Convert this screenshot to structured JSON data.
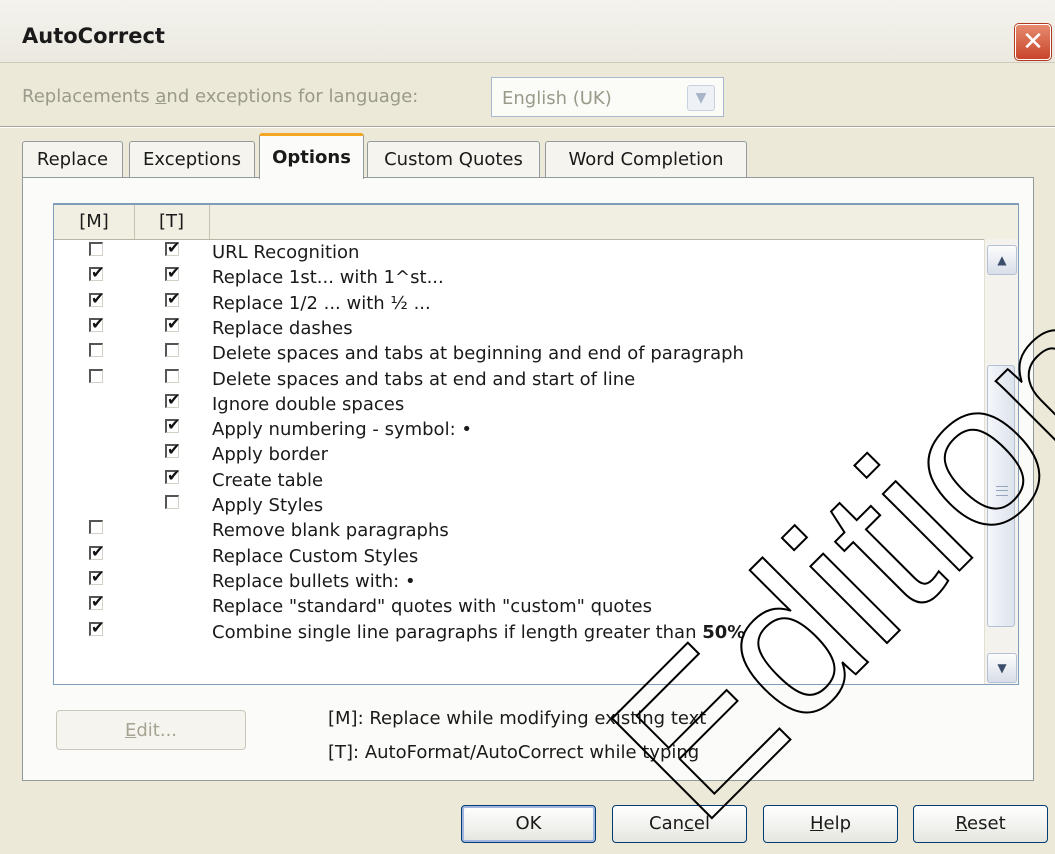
{
  "dialog": {
    "title": "AutoCorrect",
    "close_symbol": "✕"
  },
  "language": {
    "label_pre": "Replacements ",
    "label_accel": "a",
    "label_post": "nd exceptions for language:",
    "value": "English (UK)"
  },
  "tabs": [
    {
      "label": "Replace",
      "active": false
    },
    {
      "label": "Exceptions",
      "active": false
    },
    {
      "label": "Options",
      "active": true
    },
    {
      "label": "Custom Quotes",
      "active": false
    },
    {
      "label": "Word Completion",
      "active": false
    }
  ],
  "list": {
    "columns": [
      "[M]",
      "[T]"
    ],
    "rows": [
      {
        "m": false,
        "t": true,
        "label": "URL Recognition"
      },
      {
        "m": true,
        "t": true,
        "label": "Replace 1st... with 1^st..."
      },
      {
        "m": true,
        "t": true,
        "label": "Replace 1/2 ... with ½ ..."
      },
      {
        "m": true,
        "t": true,
        "label": "Replace dashes"
      },
      {
        "m": false,
        "t": false,
        "label": "Delete spaces and tabs at beginning and end of paragraph"
      },
      {
        "m": false,
        "t": false,
        "label": "Delete spaces and tabs at end and start of line"
      },
      {
        "m": null,
        "t": true,
        "label": "Ignore double spaces"
      },
      {
        "m": null,
        "t": true,
        "label": "Apply numbering - symbol: •"
      },
      {
        "m": null,
        "t": true,
        "label": "Apply border"
      },
      {
        "m": null,
        "t": true,
        "label": "Create table"
      },
      {
        "m": null,
        "t": false,
        "label": "Apply Styles"
      },
      {
        "m": false,
        "t": null,
        "label": "Remove blank paragraphs"
      },
      {
        "m": true,
        "t": null,
        "label": "Replace Custom Styles"
      },
      {
        "m": true,
        "t": null,
        "label": "Replace bullets with: •"
      },
      {
        "m": true,
        "t": null,
        "label": "Replace \"standard\" quotes with \"custom\" quotes"
      },
      {
        "m": true,
        "t": null,
        "label": "Combine single line paragraphs if length greater than ",
        "suffix_bold": "50%"
      }
    ],
    "scrollbar": {
      "up_icon": "chevron-up-icon",
      "down_icon": "chevron-down-icon"
    }
  },
  "edit_button": {
    "label_accel": "E",
    "label_rest": "dit..."
  },
  "legend": {
    "m": "[M]: Replace while modifying existing text",
    "t": "[T]: AutoFormat/AutoCorrect while typing"
  },
  "buttons": {
    "ok": "OK",
    "cancel": {
      "pre": "Can",
      "accel": "c",
      "post": "el"
    },
    "help": {
      "pre": "",
      "accel": "H",
      "post": "elp"
    },
    "reset": {
      "pre": "",
      "accel": "R",
      "post": "eset"
    }
  },
  "watermark": {
    "text": "Edition",
    "color": "#000000"
  }
}
